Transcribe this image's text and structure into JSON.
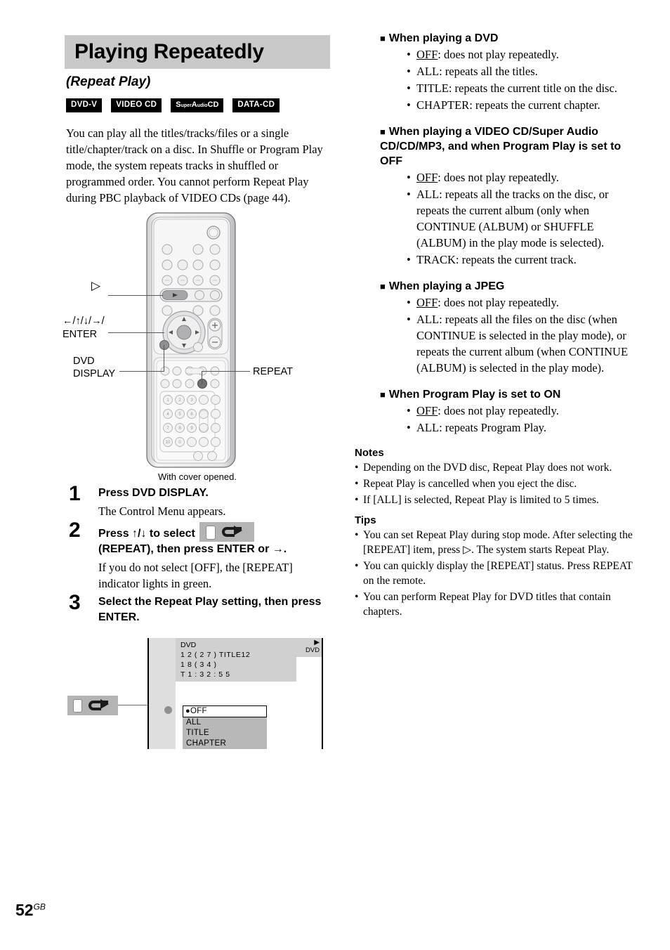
{
  "header": {
    "title": "Playing Repeatedly",
    "subtitle": "(Repeat Play)",
    "badges": [
      "DVD-V",
      "VIDEO CD",
      "SuperAudioCD",
      "DATA-CD"
    ]
  },
  "intro": "You can play all the titles/tracks/files or a single title/chapter/track on a disc.\nIn Shuffle or Program Play mode, the system repeats tracks in shuffled or programmed order. You cannot perform Repeat Play during PBC playback of VIDEO CDs (page 44).",
  "remote": {
    "caption": "With cover opened.",
    "labels": {
      "play": "▷",
      "arrows": "←/↑/↓/→/",
      "enter": "ENTER",
      "dvd": "DVD",
      "display": "DISPLAY",
      "repeat": "REPEAT"
    }
  },
  "steps": [
    {
      "num": "1",
      "head": "Press DVD DISPLAY.",
      "body": "The Control Menu appears."
    },
    {
      "num": "2",
      "head_before": "Press ↑/↓ to select",
      "head_after": "(REPEAT), then press ENTER or →.",
      "body": "If you do not select [OFF], the [REPEAT] indicator lights in green."
    },
    {
      "num": "3",
      "head": "Select the Repeat Play setting, then press ENTER.",
      "body": ""
    }
  ],
  "osd": {
    "disc_label": "DVD",
    "info_line1": "DVD",
    "info_line2": "1 2 ( 2 7 ) TITLE12",
    "info_line3": "1 8 ( 3 4 )",
    "info_line4": "T    1 : 3 2 : 5 5",
    "options": [
      "OFF",
      "ALL",
      "TITLE",
      "CHAPTER"
    ],
    "selected": "OFF"
  },
  "sections": [
    {
      "heading": "When playing a DVD",
      "items": [
        {
          "term": "OFF",
          "underline": true,
          "text": ": does not play repeatedly."
        },
        {
          "term": "ALL",
          "underline": false,
          "text": ": repeats all the titles."
        },
        {
          "term": "TITLE",
          "underline": false,
          "text": ": repeats the current title on the disc."
        },
        {
          "term": "CHAPTER",
          "underline": false,
          "text": ": repeats the current chapter."
        }
      ]
    },
    {
      "heading": "When playing a VIDEO CD/Super Audio CD/CD/MP3, and when Program Play is set to OFF",
      "items": [
        {
          "term": "OFF",
          "underline": true,
          "text": ": does not play repeatedly."
        },
        {
          "term": "ALL",
          "underline": false,
          "text": ": repeats all the tracks on the disc, or repeats the current album (only when CONTINUE (ALBUM) or SHUFFLE (ALBUM) in the play mode is selected)."
        },
        {
          "term": "TRACK",
          "underline": false,
          "text": ": repeats the current track."
        }
      ]
    },
    {
      "heading": "When playing a JPEG",
      "items": [
        {
          "term": "OFF",
          "underline": true,
          "text": ": does not play repeatedly."
        },
        {
          "term": "ALL",
          "underline": false,
          "text": ": repeats all the files on the disc (when CONTINUE is selected in the play mode), or repeats the current album (when CONTINUE (ALBUM) is selected in the play mode)."
        }
      ]
    },
    {
      "heading": "When Program Play is set to ON",
      "items": [
        {
          "term": "OFF",
          "underline": true,
          "text": ": does not play repeatedly."
        },
        {
          "term": "ALL",
          "underline": false,
          "text": ": repeats Program Play."
        }
      ]
    }
  ],
  "notes": {
    "heading": "Notes",
    "items": [
      "Depending on the DVD disc, Repeat Play does not work.",
      "Repeat Play is cancelled when you eject the disc.",
      "If [ALL] is selected, Repeat Play is limited to 5 times."
    ]
  },
  "tips": {
    "heading": "Tips",
    "items": [
      "You can set Repeat Play during stop mode. After selecting the [REPEAT] item, press ▷. The system starts Repeat Play.",
      "You can quickly display the [REPEAT] status. Press REPEAT on the remote.",
      "You can perform Repeat Play for DVD titles that contain chapters."
    ]
  },
  "footer": {
    "page": "52",
    "region": "GB"
  }
}
